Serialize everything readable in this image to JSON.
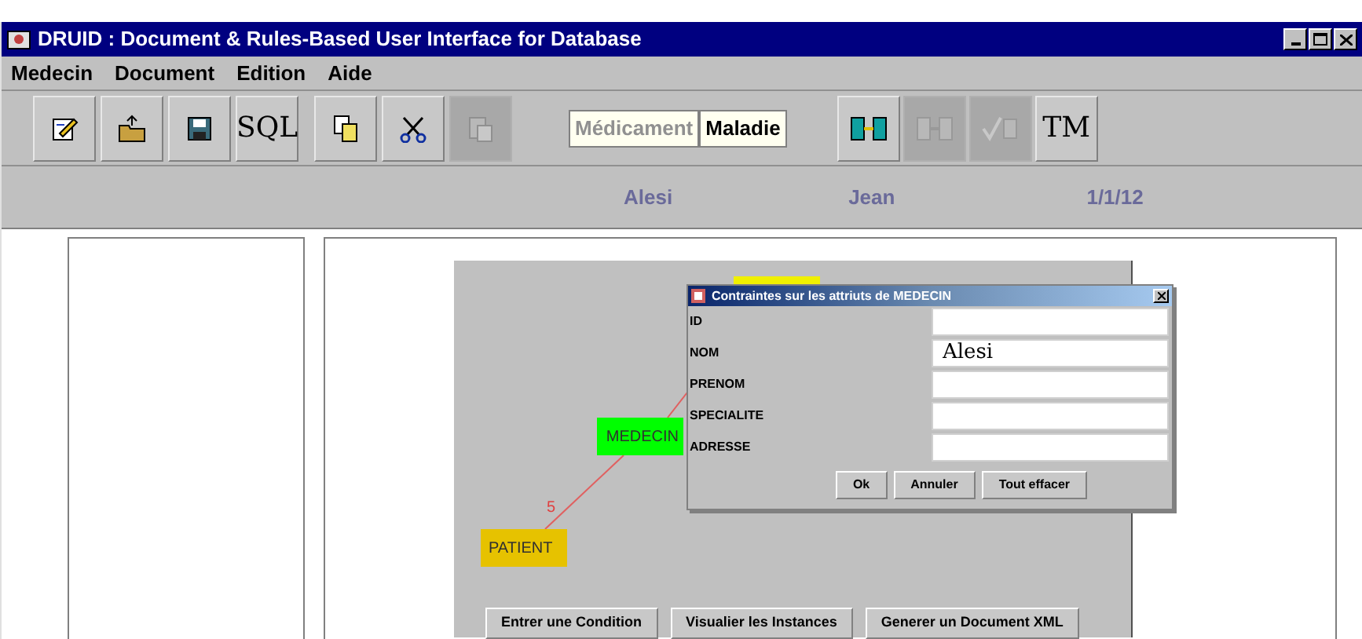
{
  "window": {
    "title": "DRUID : Document & Rules-Based User Interface for Database"
  },
  "menu": [
    "Medecin",
    "Document",
    "Edition",
    "Aide"
  ],
  "toolbar": [
    {
      "kind": "icon",
      "disabled": false
    },
    {
      "kind": "icon",
      "disabled": false
    },
    {
      "kind": "icon",
      "disabled": false
    },
    {
      "kind": "text",
      "label": "SQL",
      "disabled": false
    },
    {
      "kind": "icon",
      "disabled": false
    },
    {
      "kind": "icon",
      "disabled": false
    },
    {
      "kind": "icon",
      "disabled": true
    }
  ],
  "mode_tabs": [
    {
      "label": "Médicament",
      "selected": false
    },
    {
      "label": "Maladie",
      "selected": true
    }
  ],
  "toolbar_right": [
    {
      "kind": "icon",
      "disabled": false
    },
    {
      "kind": "icon",
      "disabled": true
    },
    {
      "kind": "icon",
      "disabled": true
    },
    {
      "kind": "text",
      "label": "TM",
      "disabled": false
    }
  ],
  "info": [
    "Alesi",
    "Jean",
    "1/1/12"
  ],
  "diagram": {
    "nodes": [
      {
        "label": "MEDECIN",
        "color": "#00ff00"
      },
      {
        "label": "PATIENT",
        "color": "#e6c200"
      }
    ],
    "edge_label": "5",
    "buttons": [
      "Entrer une Condition",
      "Visualier les Instances",
      "Generer un Document XML"
    ]
  },
  "dialog": {
    "title": "Contraintes sur les attriuts de MEDECIN",
    "fields": [
      {
        "label": "ID"
      },
      {
        "label": "NOM",
        "value": "Alesi"
      },
      {
        "label": "PRENOM"
      },
      {
        "label": "SPECIALITE"
      },
      {
        "label": "ADRESSE"
      }
    ],
    "buttons": [
      "Ok",
      "Annuler",
      "Tout effacer"
    ]
  }
}
